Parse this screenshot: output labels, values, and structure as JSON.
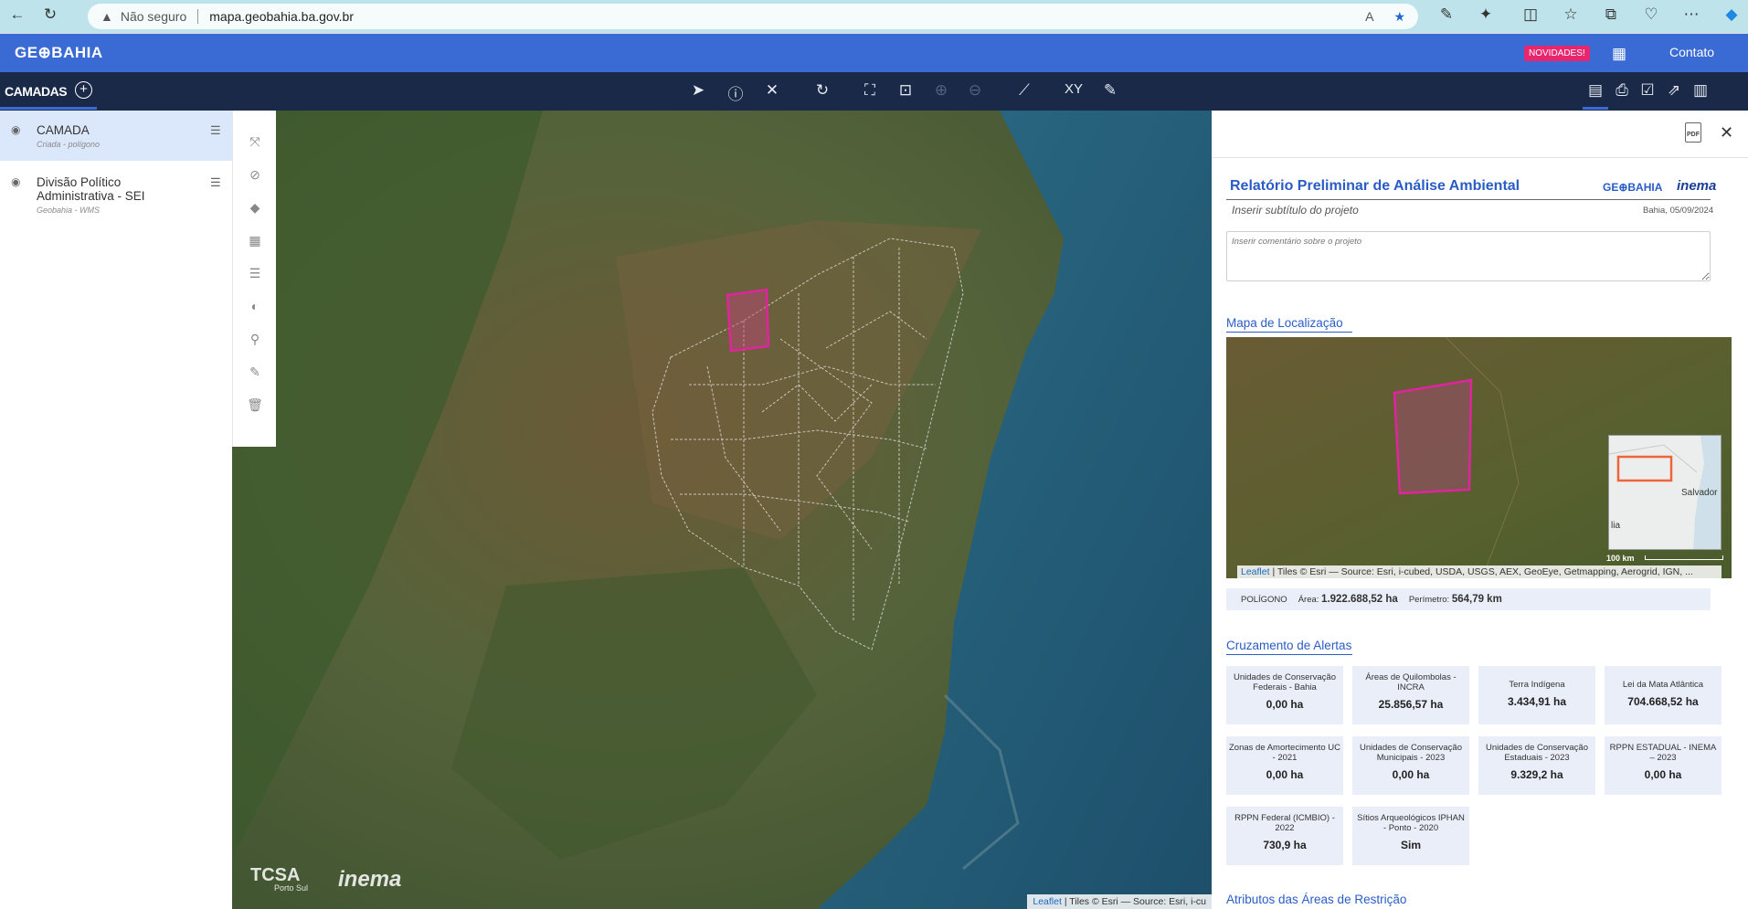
{
  "browser": {
    "security_label": "Não seguro",
    "url": "mapa.geobahia.ba.gov.br"
  },
  "header": {
    "logo": "GE⊕BAHIA",
    "novidades_label": "NOVIDADES!",
    "contato_label": "Contato"
  },
  "toolbar": {
    "layers_title": "CAMADAS",
    "tools": [
      "select-arrow-icon",
      "info-pin-icon",
      "tools-icon",
      "refresh-icon",
      "zoom-extent-icon",
      "zoom-selection-icon",
      "zoom-in-icon",
      "zoom-out-icon",
      "ruler-icon",
      "xy-coordinates-icon",
      "pen-edit-icon"
    ],
    "xy_label": "XY",
    "right_tools": [
      "report-icon",
      "print-icon",
      "export-icon",
      "share-icon",
      "book-icon"
    ]
  },
  "layers": [
    {
      "name": "CAMADA",
      "subtitle": "Criada - polígono",
      "active": true
    },
    {
      "name": "Divisão Político Administrativa - SEI",
      "subtitle": "Geobahia - WMS",
      "active": false
    }
  ],
  "side_tools": [
    "zoom-to-layer-icon",
    "hide-layer-icon",
    "tag-icon",
    "table-icon",
    "legend-icon",
    "opacity-icon",
    "search-user-icon",
    "edit-icon",
    "delete-icon"
  ],
  "map": {
    "attribution_link": "Leaflet",
    "attribution_text": " | Tiles © Esri — Source: Esri, i-cu",
    "brand_tcsa": "TCSA",
    "brand_tcsa_sub": "Porto Sul",
    "brand_inema": "inema"
  },
  "report": {
    "title": "Relatório Preliminar de Análise Ambiental",
    "logo_geobahia": "GE⊕BAHIA",
    "logo_inema": "inema",
    "subtitle_placeholder": "Inserir subtítulo do projeto",
    "date": "Bahia, 05/09/2024",
    "comment_placeholder": "Inserir comentário sobre o projeto",
    "location_section": "Mapa de Localização",
    "inset_city": "Salvador",
    "inset_city2": "lia",
    "scale_label": "100 km",
    "minimap_attrib_link": "Leaflet",
    "minimap_attrib_text": " | Tiles © Esri — Source: Esri, i-cubed, USDA, USGS, AEX, GeoEye, Getmapping, Aerogrid, IGN, ...",
    "polygon": {
      "type_label": "POLÍGONO",
      "area_label": "Área:",
      "area_value": "1.922.688,52 ha",
      "perimeter_label": "Perímetro:",
      "perimeter_value": "564,79 km"
    },
    "alerts_section": "Cruzamento de Alertas",
    "alerts": [
      {
        "label": "Unidades de Conservação Federais - Bahia",
        "value": "0,00 ha"
      },
      {
        "label": "Áreas de Quilombolas - INCRA",
        "value": "25.856,57 ha"
      },
      {
        "label": "Terra Indígena",
        "value": "3.434,91 ha"
      },
      {
        "label": "Lei da Mata Atlântica",
        "value": "704.668,52 ha"
      },
      {
        "label": "Zonas de Amortecimento UC - 2021",
        "value": "0,00 ha"
      },
      {
        "label": "Unidades de Conservação Municipais - 2023",
        "value": "0,00 ha"
      },
      {
        "label": "Unidades de Conservação Estaduais - 2023",
        "value": "9.329,2 ha"
      },
      {
        "label": "RPPN ESTADUAL - INEMA – 2023",
        "value": "0,00 ha"
      },
      {
        "label": "RPPN Federal (ICMBIO) - 2022",
        "value": "730,9 ha"
      },
      {
        "label": "Sítios Arqueológicos IPHAN - Ponto - 2020",
        "value": "Sim"
      }
    ],
    "restrictions_section": "Atributos das Áreas de Restrição"
  },
  "colors": {
    "header": "#3a6ad4",
    "toolbar": "#192947",
    "accent": "#2a5cc6",
    "polygon": "#e0249e",
    "badge": "#e8266e"
  }
}
